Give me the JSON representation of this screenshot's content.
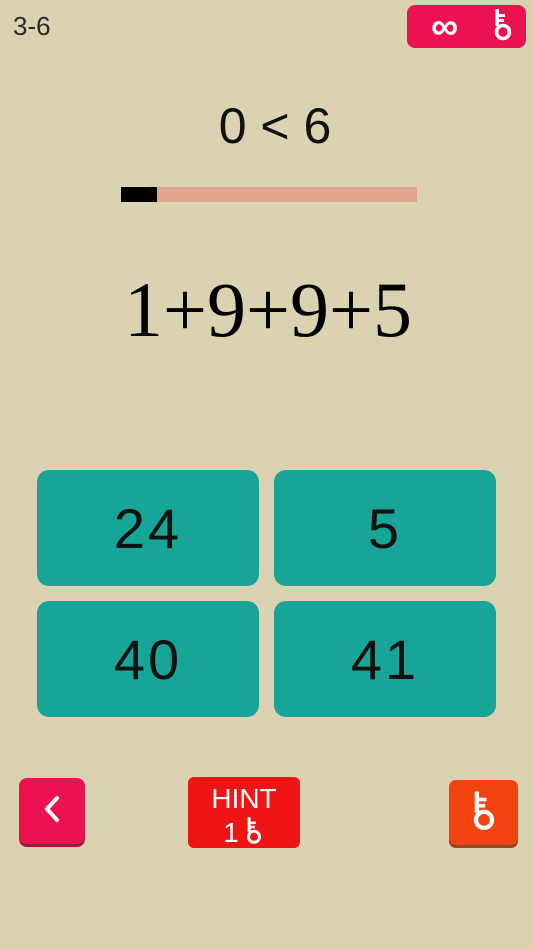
{
  "header": {
    "level": "3-6",
    "keys_count": "∞"
  },
  "progress": {
    "text": "0 < 6",
    "current": 0,
    "total": 6,
    "fill_fraction": 0.12
  },
  "puzzle": {
    "equation": "1+9+9+5"
  },
  "answers": [
    "24",
    "5",
    "40",
    "41"
  ],
  "controls": {
    "hint_label": "HINT",
    "hint_cost": "1"
  },
  "colors": {
    "background": "#dbd2b1",
    "answer_tile": "#16a596",
    "badge": "#ec1150",
    "hint": "#f01515",
    "key_button": "#f1420f",
    "progress_track": "#e0a58a",
    "progress_fill": "#000000"
  },
  "icons": {
    "badge_icon": "key-icon",
    "back_icon": "chevron-left-icon",
    "hint_icon": "key-icon",
    "key_button_icon": "key-icon"
  }
}
